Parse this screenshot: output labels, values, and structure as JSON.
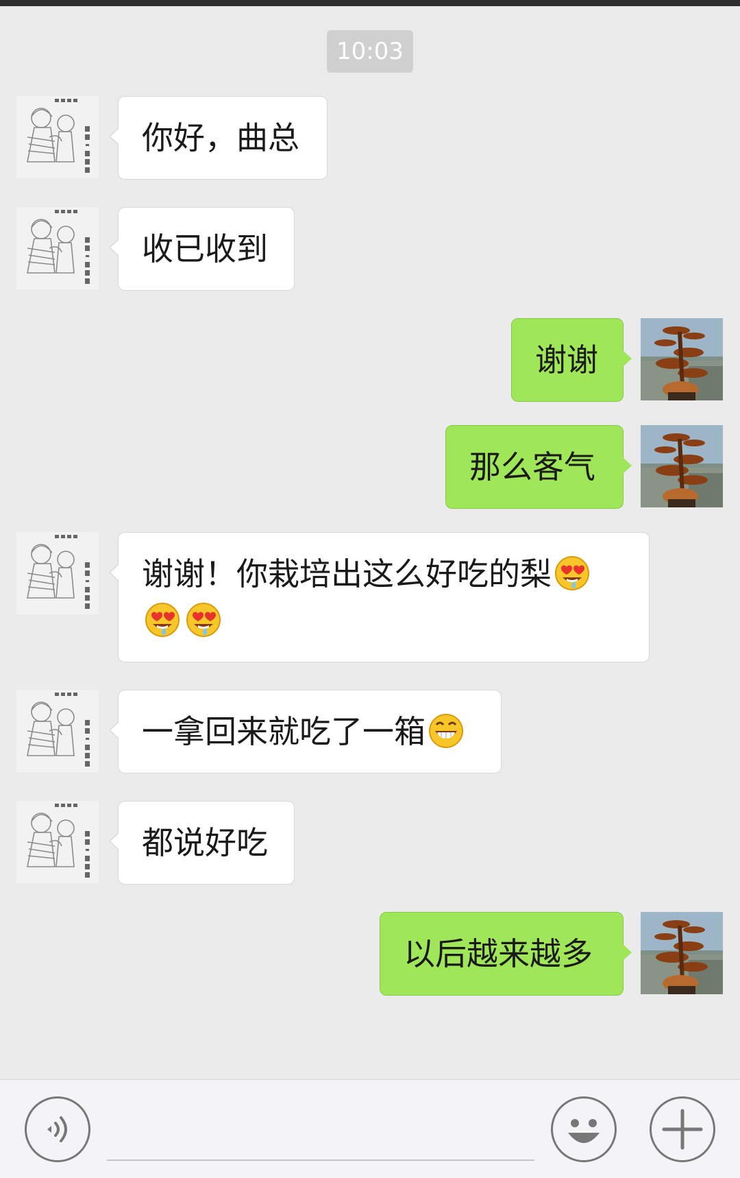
{
  "chat": {
    "timestamp": "10:03",
    "messages": [
      {
        "side": "left",
        "text": "你好，曲总"
      },
      {
        "side": "left",
        "text": "收已收到"
      },
      {
        "side": "right",
        "text": "谢谢"
      },
      {
        "side": "right",
        "text": "那么客气"
      },
      {
        "side": "left",
        "line1": "谢谢！你栽培出这么好吃的梨",
        "emoji": "heart-eyes-drool-emoji"
      },
      {
        "side": "left",
        "text": "一拿回来就吃了一箱",
        "emoji": "grinning-teeth-emoji"
      },
      {
        "side": "left",
        "text": "都说好吃"
      },
      {
        "side": "right",
        "text": "以后越来越多"
      }
    ]
  },
  "input_bar": {
    "voice_icon": "voice-icon",
    "emoji_icon": "smiley-face-icon",
    "more_icon": "plus-icon"
  },
  "colors": {
    "background": "#ebebeb",
    "sent_bubble": "#9fe658",
    "received_bubble": "#ffffff",
    "timestamp_badge": "#d0d0d0"
  }
}
